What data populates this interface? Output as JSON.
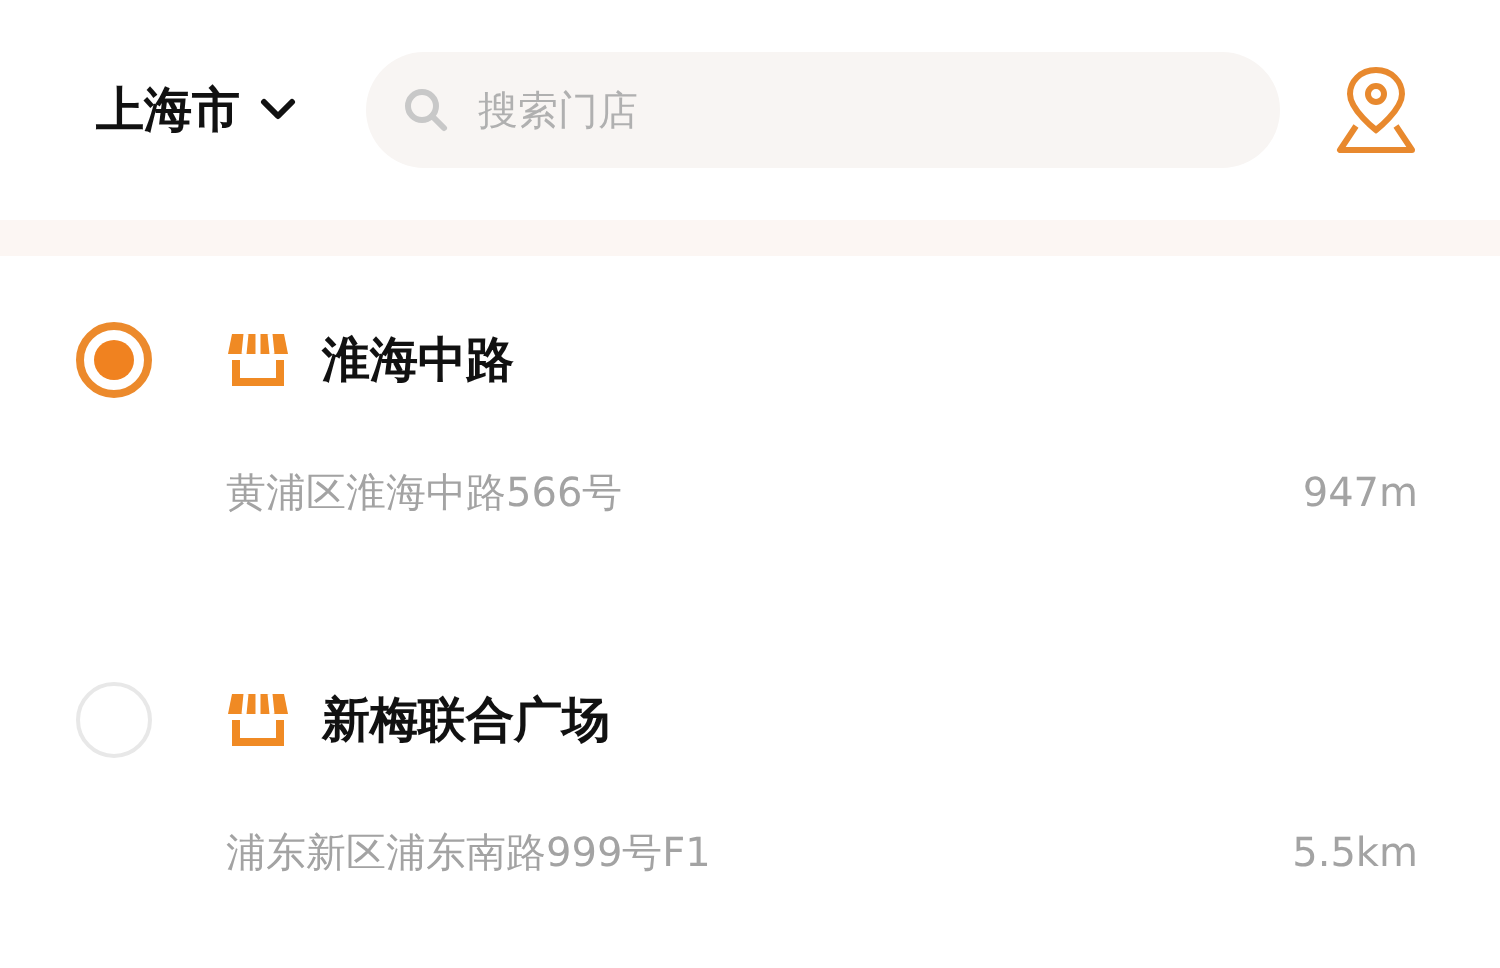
{
  "header": {
    "city": "上海市",
    "search": {
      "placeholder": "搜索门店"
    }
  },
  "stores": [
    {
      "name": "淮海中路",
      "address": "黄浦区淮海中路566号",
      "distance": "947m",
      "selected": true
    },
    {
      "name": "新梅联合广场",
      "address": "浦东新区浦东南路999号F1",
      "distance": "5.5km",
      "selected": false
    }
  ]
}
